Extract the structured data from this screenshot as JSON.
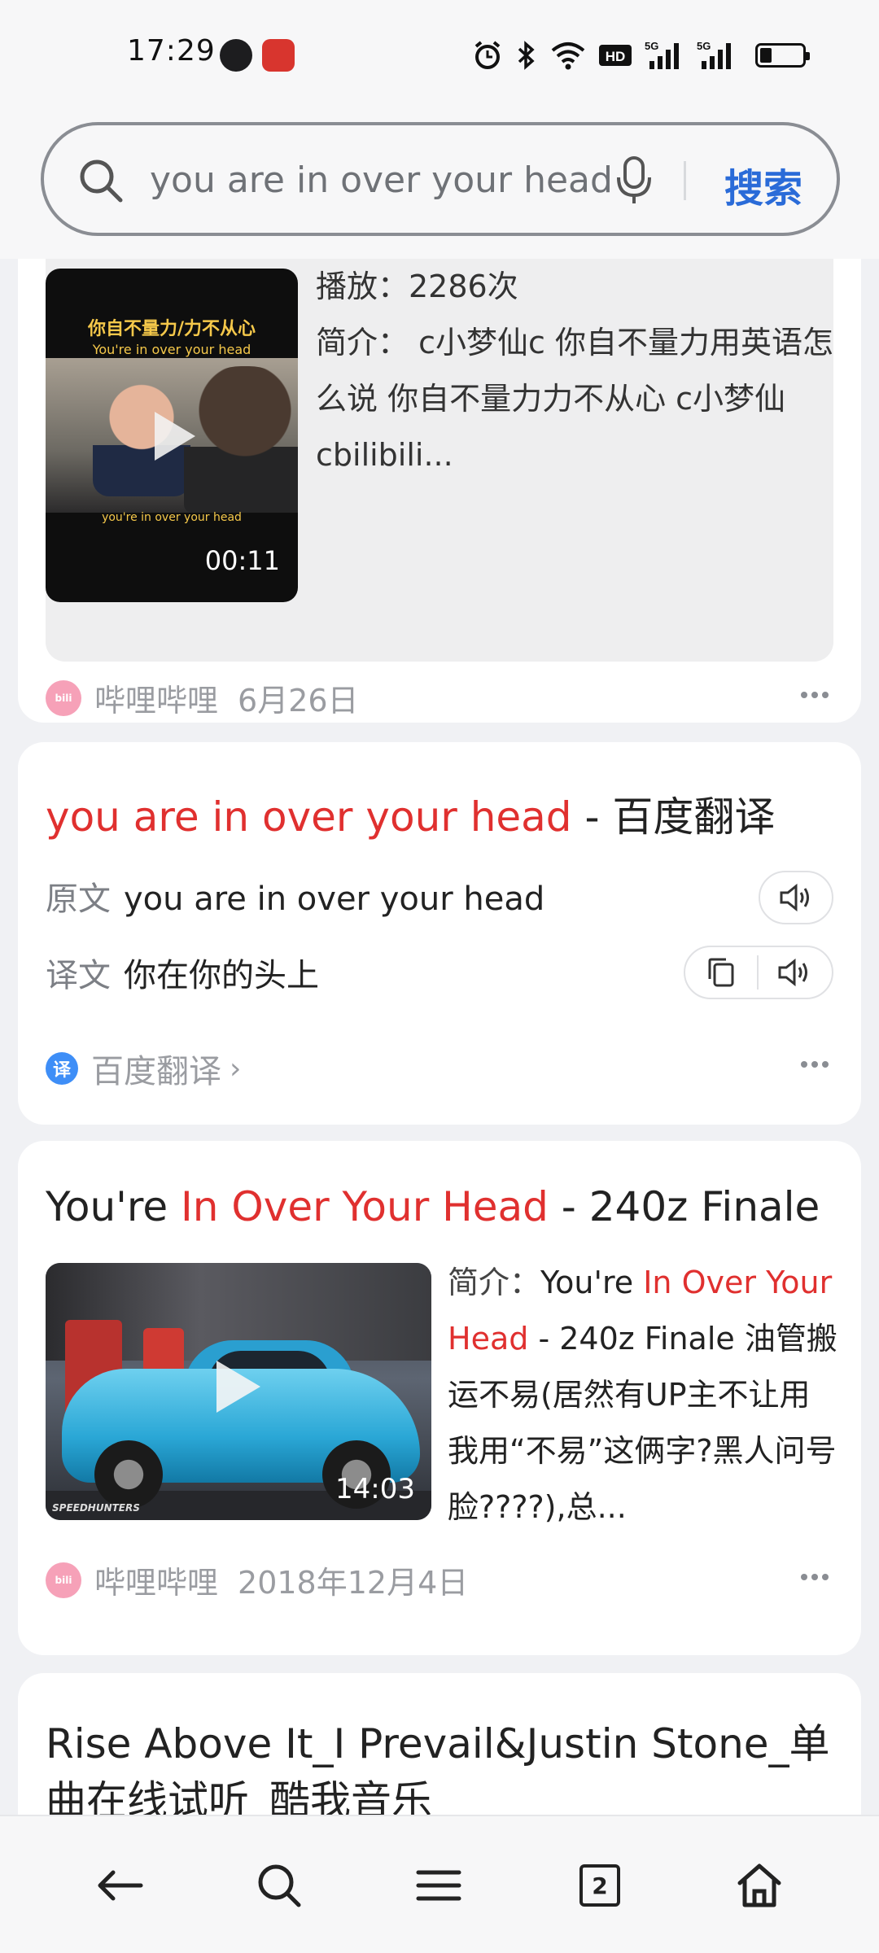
{
  "status_bar": {
    "time": "17:29",
    "network_label": "5G",
    "hd_label": "HD"
  },
  "search": {
    "query": "you are in over your head",
    "button_label": "搜索"
  },
  "results": [
    {
      "play_count": "播放：2286次",
      "description_label": "简介：",
      "description": "c小梦仙c 你自不量力用英语怎么说 你自不量力力不从心 c小梦仙cbilibili...",
      "thumbnail": {
        "caption_cn": "你自不量力/力不从心",
        "caption_en": "You're in over your head",
        "subtitle": "you're in over your head",
        "duration": "00:11"
      },
      "source": "哔哩哔哩",
      "date": "6月26日"
    },
    {
      "title_highlight": "you are in over your head",
      "title_rest": " - 百度翻译",
      "source_label": "原文",
      "source_text": "you are in over your head",
      "target_label": "译文",
      "target_text": "你在你的头上",
      "source": "百度翻译",
      "source_logo": "译"
    },
    {
      "title_prefix": "You're ",
      "title_highlight": "In Over Your Head",
      "title_suffix": " - 240z Finale",
      "description_label": "简介：",
      "description_prefix": "You're ",
      "description_highlight": "In Over Your Head",
      "description_rest": " - 240z Finale 油管搬运不易(居然有UP主不让用我用“不易”这俩字?黑人问号脸????),总...",
      "thumbnail": {
        "watermark": "SPEEDHUNTERS",
        "duration": "14:03"
      },
      "source": "哔哩哔哩",
      "date": "2018年12月4日"
    },
    {
      "title": "Rise Above It_I Prevail&Justin Stone_单曲在线试听_酷我音乐"
    }
  ],
  "bottom_nav": {
    "tab_count": "2"
  },
  "colors": {
    "highlight": "#e0302f",
    "accent": "#2a6bd8",
    "bilibili": "#f6a1b8"
  }
}
